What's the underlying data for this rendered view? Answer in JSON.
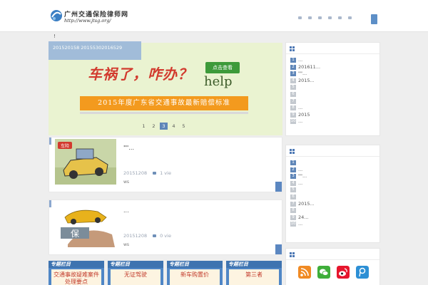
{
  "header": {
    "site_name": "广州交通保险律师网",
    "site_url": "http://www.jtsg.org/",
    "nav_items": [
      "nav-1",
      "nav-2",
      "nav-3",
      "nav-4",
      "nav-5",
      "nav-6"
    ]
  },
  "notice": "!",
  "slider": {
    "caption": "201520158 20155302016529",
    "headline": "车祸了，咋办？",
    "help": "help",
    "cta": "点击查看",
    "banner": "2015年度广东省交通事故最新赔偿标准",
    "pages": [
      "1",
      "2",
      "3",
      "4",
      "5"
    ],
    "active_page": "3"
  },
  "posts": [
    {
      "title": "\"\"...",
      "date": "20151208",
      "views": "1 vie",
      "tag": "ws",
      "thumb_text": "车险"
    },
    {
      "title": "...",
      "date": "20151208",
      "views": "0 vie",
      "tag": "ws",
      "thumb_text": "保"
    }
  ],
  "categories": [
    {
      "header": "专题栏目",
      "body": "交通事故疑难案件处理要点"
    },
    {
      "header": "专题栏目",
      "body": "无证驾驶"
    },
    {
      "header": "专题栏目",
      "body": "新车购置价"
    },
    {
      "header": "专题栏目",
      "body": "第三者"
    }
  ],
  "widgets": [
    {
      "items": [
        {
          "n": "1",
          "text": "..."
        },
        {
          "n": "2",
          "text": "201611..."
        },
        {
          "n": "3",
          "text": "\"\"..."
        },
        {
          "n": "4",
          "text": "2015..."
        },
        {
          "n": "5",
          "text": ""
        },
        {
          "n": "6",
          "text": ""
        },
        {
          "n": "7",
          "text": ""
        },
        {
          "n": "8",
          "text": "..."
        },
        {
          "n": "9",
          "text": "2015"
        },
        {
          "n": "10",
          "text": "..."
        }
      ]
    },
    {
      "items": [
        {
          "n": "1",
          "text": ""
        },
        {
          "n": "2",
          "text": "..."
        },
        {
          "n": "3",
          "text": "\"\"..."
        },
        {
          "n": "4",
          "text": "..."
        },
        {
          "n": "5",
          "text": ""
        },
        {
          "n": "6",
          "text": ""
        },
        {
          "n": "7",
          "text": "2015..."
        },
        {
          "n": "8",
          "text": ""
        },
        {
          "n": "9",
          "text": "24..."
        },
        {
          "n": "10",
          "text": "..."
        }
      ]
    }
  ],
  "social": [
    "rss-icon",
    "wechat-icon",
    "weibo-icon",
    "tencent-weibo-icon"
  ],
  "colors": {
    "accent": "#5f86b8",
    "banner": "#f39a1e",
    "headline": "#d23a2e",
    "cta": "#3d9a3a"
  }
}
